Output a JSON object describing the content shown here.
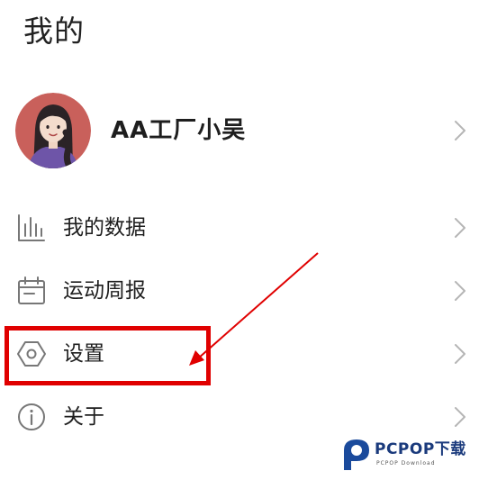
{
  "header": {
    "title": "我的"
  },
  "profile": {
    "name": "AA工厂小吴",
    "avatar_bg": "#c9605b"
  },
  "menu": {
    "items": [
      {
        "label": "我的数据",
        "icon": "bar-chart-icon"
      },
      {
        "label": "运动周报",
        "icon": "calendar-icon"
      },
      {
        "label": "设置",
        "icon": "hexagon-settings-icon"
      },
      {
        "label": "关于",
        "icon": "info-icon"
      }
    ]
  },
  "annotation": {
    "color": "#e00000",
    "highlighted_item": "设置"
  },
  "watermark": {
    "brand": "PCPOP下载",
    "sub": "PCPOP Download"
  }
}
